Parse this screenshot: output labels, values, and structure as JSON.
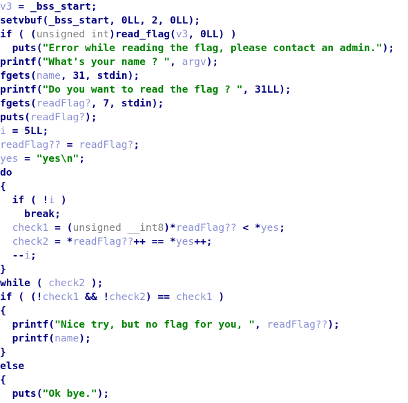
{
  "view": {
    "title": "Decompiler pseudocode listing",
    "background": "#ffffff",
    "line_height_px": 20,
    "font_size_px": 14.6
  },
  "colors": {
    "keyword": "#00007f",
    "function": "#00007f",
    "variable": "#8a8fd4",
    "string": "#008000",
    "number": "#00007f",
    "type": "#808080",
    "punctuation": "#00007f",
    "background": "#ffffff"
  },
  "lines": [
    {
      "index": 0,
      "text": "v3 = _bss_start;",
      "tokens": [
        {
          "t": "v3",
          "c": "var"
        },
        {
          "t": " = ",
          "c": "punct"
        },
        {
          "t": "_bss_start",
          "c": "fn"
        },
        {
          "t": ";",
          "c": "punct"
        }
      ]
    },
    {
      "index": 1,
      "text": "setvbuf(_bss_start, 0LL, 2, 0LL);",
      "tokens": [
        {
          "t": "setvbuf",
          "c": "fn"
        },
        {
          "t": "(",
          "c": "punct"
        },
        {
          "t": "_bss_start",
          "c": "fn"
        },
        {
          "t": ", ",
          "c": "punct"
        },
        {
          "t": "0LL",
          "c": "num"
        },
        {
          "t": ", ",
          "c": "punct"
        },
        {
          "t": "2",
          "c": "num"
        },
        {
          "t": ", ",
          "c": "punct"
        },
        {
          "t": "0LL",
          "c": "num"
        },
        {
          "t": ");",
          "c": "punct"
        }
      ]
    },
    {
      "index": 2,
      "text": "if ( (unsigned int)read_flag(v3, 0LL) )",
      "tokens": [
        {
          "t": "if",
          "c": "kw"
        },
        {
          "t": " ( (",
          "c": "punct"
        },
        {
          "t": "unsigned int",
          "c": "type"
        },
        {
          "t": ")",
          "c": "punct"
        },
        {
          "t": "read_flag",
          "c": "fn"
        },
        {
          "t": "(",
          "c": "punct"
        },
        {
          "t": "v3",
          "c": "var"
        },
        {
          "t": ", ",
          "c": "punct"
        },
        {
          "t": "0LL",
          "c": "num"
        },
        {
          "t": ") )",
          "c": "punct"
        }
      ]
    },
    {
      "index": 3,
      "text": "  puts(\"Error while reading the flag, please contact an admin.\");",
      "tokens": [
        {
          "t": "  ",
          "c": "plain"
        },
        {
          "t": "puts",
          "c": "fn"
        },
        {
          "t": "(",
          "c": "punct"
        },
        {
          "t": "\"Error while reading the flag, please contact an admin.\"",
          "c": "str"
        },
        {
          "t": ");",
          "c": "punct"
        }
      ]
    },
    {
      "index": 4,
      "text": "printf(\"What's your name ? \", argv);",
      "tokens": [
        {
          "t": "printf",
          "c": "fn"
        },
        {
          "t": "(",
          "c": "punct"
        },
        {
          "t": "\"What's your name ? \"",
          "c": "str"
        },
        {
          "t": ", ",
          "c": "punct"
        },
        {
          "t": "argv",
          "c": "var"
        },
        {
          "t": ");",
          "c": "punct"
        }
      ]
    },
    {
      "index": 5,
      "text": "fgets(name, 31, stdin);",
      "tokens": [
        {
          "t": "fgets",
          "c": "fn"
        },
        {
          "t": "(",
          "c": "punct"
        },
        {
          "t": "name",
          "c": "var"
        },
        {
          "t": ", ",
          "c": "punct"
        },
        {
          "t": "31",
          "c": "num"
        },
        {
          "t": ", ",
          "c": "punct"
        },
        {
          "t": "stdin",
          "c": "fn"
        },
        {
          "t": ");",
          "c": "punct"
        }
      ]
    },
    {
      "index": 6,
      "text": "printf(\"Do you want to read the flag ? \", 31LL);",
      "tokens": [
        {
          "t": "printf",
          "c": "fn"
        },
        {
          "t": "(",
          "c": "punct"
        },
        {
          "t": "\"Do you want to read the flag ? \"",
          "c": "str"
        },
        {
          "t": ", ",
          "c": "punct"
        },
        {
          "t": "31LL",
          "c": "num"
        },
        {
          "t": ");",
          "c": "punct"
        }
      ]
    },
    {
      "index": 7,
      "text": "fgets(readFlag?, 7, stdin);",
      "tokens": [
        {
          "t": "fgets",
          "c": "fn"
        },
        {
          "t": "(",
          "c": "punct"
        },
        {
          "t": "readFlag?",
          "c": "var"
        },
        {
          "t": ", ",
          "c": "punct"
        },
        {
          "t": "7",
          "c": "num"
        },
        {
          "t": ", ",
          "c": "punct"
        },
        {
          "t": "stdin",
          "c": "fn"
        },
        {
          "t": ");",
          "c": "punct"
        }
      ]
    },
    {
      "index": 8,
      "text": "puts(readFlag?);",
      "tokens": [
        {
          "t": "puts",
          "c": "fn"
        },
        {
          "t": "(",
          "c": "punct"
        },
        {
          "t": "readFlag?",
          "c": "var"
        },
        {
          "t": ");",
          "c": "punct"
        }
      ]
    },
    {
      "index": 9,
      "text": "i = 5LL;",
      "tokens": [
        {
          "t": "i",
          "c": "var"
        },
        {
          "t": " = ",
          "c": "punct"
        },
        {
          "t": "5LL",
          "c": "num"
        },
        {
          "t": ";",
          "c": "punct"
        }
      ]
    },
    {
      "index": 10,
      "text": "readFlag?? = readFlag?;",
      "tokens": [
        {
          "t": "readFlag??",
          "c": "var"
        },
        {
          "t": " = ",
          "c": "punct"
        },
        {
          "t": "readFlag?",
          "c": "var"
        },
        {
          "t": ";",
          "c": "punct"
        }
      ]
    },
    {
      "index": 11,
      "text": "yes = \"yes\\n\";",
      "tokens": [
        {
          "t": "yes",
          "c": "var"
        },
        {
          "t": " = ",
          "c": "punct"
        },
        {
          "t": "\"yes\\n\"",
          "c": "str"
        },
        {
          "t": ";",
          "c": "punct"
        }
      ]
    },
    {
      "index": 12,
      "text": "do",
      "tokens": [
        {
          "t": "do",
          "c": "kw"
        }
      ]
    },
    {
      "index": 13,
      "text": "{",
      "tokens": [
        {
          "t": "{",
          "c": "punct"
        }
      ]
    },
    {
      "index": 14,
      "text": "  if ( !i )",
      "tokens": [
        {
          "t": "  ",
          "c": "plain"
        },
        {
          "t": "if",
          "c": "kw"
        },
        {
          "t": " ( !",
          "c": "punct"
        },
        {
          "t": "i",
          "c": "var"
        },
        {
          "t": " )",
          "c": "punct"
        }
      ]
    },
    {
      "index": 15,
      "text": "    break;",
      "tokens": [
        {
          "t": "    ",
          "c": "plain"
        },
        {
          "t": "break",
          "c": "kw"
        },
        {
          "t": ";",
          "c": "punct"
        }
      ]
    },
    {
      "index": 16,
      "text": "  check1 = (unsigned __int8)*readFlag?? < *yes;",
      "tokens": [
        {
          "t": "  ",
          "c": "plain"
        },
        {
          "t": "check1",
          "c": "var"
        },
        {
          "t": " = (",
          "c": "punct"
        },
        {
          "t": "unsigned __int8",
          "c": "type"
        },
        {
          "t": ")*",
          "c": "punct"
        },
        {
          "t": "readFlag??",
          "c": "var"
        },
        {
          "t": " < *",
          "c": "punct"
        },
        {
          "t": "yes",
          "c": "var"
        },
        {
          "t": ";",
          "c": "punct"
        }
      ]
    },
    {
      "index": 17,
      "text": "  check2 = *readFlag??++ == *yes++;",
      "tokens": [
        {
          "t": "  ",
          "c": "plain"
        },
        {
          "t": "check2",
          "c": "var"
        },
        {
          "t": " = *",
          "c": "punct"
        },
        {
          "t": "readFlag??",
          "c": "var"
        },
        {
          "t": "++ == *",
          "c": "punct"
        },
        {
          "t": "yes",
          "c": "var"
        },
        {
          "t": "++;",
          "c": "punct"
        }
      ]
    },
    {
      "index": 18,
      "text": "  --i;",
      "tokens": [
        {
          "t": "  ",
          "c": "plain"
        },
        {
          "t": "--",
          "c": "punct"
        },
        {
          "t": "i",
          "c": "var"
        },
        {
          "t": ";",
          "c": "punct"
        }
      ]
    },
    {
      "index": 19,
      "text": "}",
      "tokens": [
        {
          "t": "}",
          "c": "punct"
        }
      ]
    },
    {
      "index": 20,
      "text": "while ( check2 );",
      "tokens": [
        {
          "t": "while",
          "c": "kw"
        },
        {
          "t": " ( ",
          "c": "punct"
        },
        {
          "t": "check2",
          "c": "var"
        },
        {
          "t": " );",
          "c": "punct"
        }
      ]
    },
    {
      "index": 21,
      "text": "if ( (!check1 && !check2) == check1 )",
      "tokens": [
        {
          "t": "if",
          "c": "kw"
        },
        {
          "t": " ( (!",
          "c": "punct"
        },
        {
          "t": "check1",
          "c": "var"
        },
        {
          "t": " && !",
          "c": "punct"
        },
        {
          "t": "check2",
          "c": "var"
        },
        {
          "t": ") == ",
          "c": "punct"
        },
        {
          "t": "check1",
          "c": "var"
        },
        {
          "t": " )",
          "c": "punct"
        }
      ]
    },
    {
      "index": 22,
      "text": "{",
      "tokens": [
        {
          "t": "{",
          "c": "punct"
        }
      ]
    },
    {
      "index": 23,
      "text": "  printf(\"Nice try, but no flag for you, \", readFlag??);",
      "tokens": [
        {
          "t": "  ",
          "c": "plain"
        },
        {
          "t": "printf",
          "c": "fn"
        },
        {
          "t": "(",
          "c": "punct"
        },
        {
          "t": "\"Nice try, but no flag for you, \"",
          "c": "str"
        },
        {
          "t": ", ",
          "c": "punct"
        },
        {
          "t": "readFlag??",
          "c": "var"
        },
        {
          "t": ");",
          "c": "punct"
        }
      ]
    },
    {
      "index": 24,
      "text": "  printf(name);",
      "tokens": [
        {
          "t": "  ",
          "c": "plain"
        },
        {
          "t": "printf",
          "c": "fn"
        },
        {
          "t": "(",
          "c": "punct"
        },
        {
          "t": "name",
          "c": "var"
        },
        {
          "t": ");",
          "c": "punct"
        }
      ]
    },
    {
      "index": 25,
      "text": "}",
      "tokens": [
        {
          "t": "}",
          "c": "punct"
        }
      ]
    },
    {
      "index": 26,
      "text": "else",
      "tokens": [
        {
          "t": "else",
          "c": "kw"
        }
      ]
    },
    {
      "index": 27,
      "text": "{",
      "tokens": [
        {
          "t": "{",
          "c": "punct"
        }
      ]
    },
    {
      "index": 28,
      "text": "  puts(\"Ok bye.\");",
      "tokens": [
        {
          "t": "  ",
          "c": "plain"
        },
        {
          "t": "puts",
          "c": "fn"
        },
        {
          "t": "(",
          "c": "punct"
        },
        {
          "t": "\"Ok bye.\"",
          "c": "str"
        },
        {
          "t": ");",
          "c": "punct"
        }
      ]
    }
  ]
}
